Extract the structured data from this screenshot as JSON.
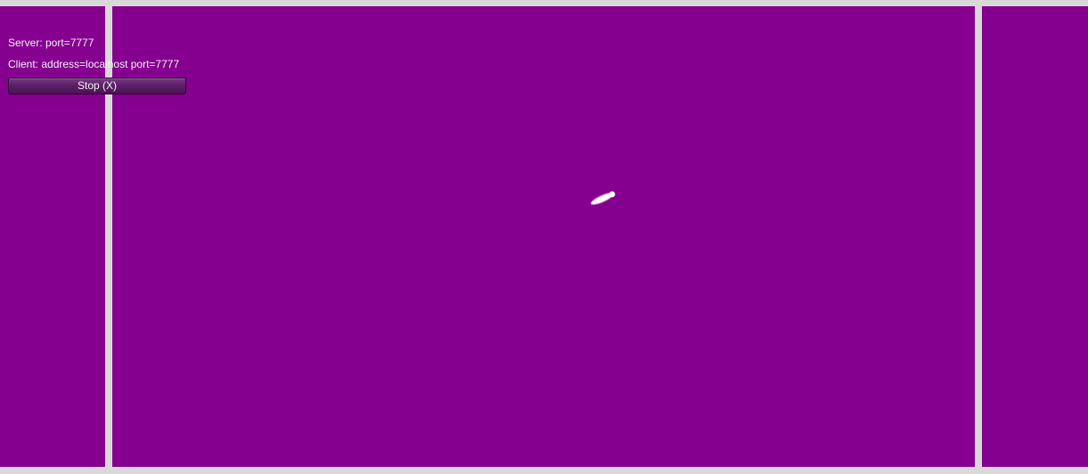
{
  "hud": {
    "server_text": "Server: port=7777",
    "client_text": "Client: address=localhost port=7777",
    "stop_button_label": "Stop (X)"
  },
  "colors": {
    "field": "#85008f",
    "wall": "#d9d9d9",
    "text": "#f2f2f2"
  },
  "icons": {
    "ball": "ball-icon"
  }
}
